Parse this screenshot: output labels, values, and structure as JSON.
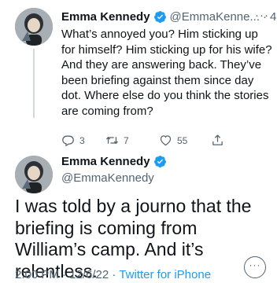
{
  "parent_tweet": {
    "author_name": "Emma Kennedy",
    "handle": "@EmmaKenne...",
    "dot": "·",
    "time": "4h",
    "more": "···",
    "text": "What’s annoyed you? Him sticking up for himself? Him sticking up for his wife? And they are answering back. They’ve been briefing against them since day dot. Where else do you think the stories are coming from?",
    "replies": "3",
    "retweets": "7",
    "likes": "55"
  },
  "main_tweet": {
    "author_name": "Emma Kennedy",
    "handle": "@EmmaKennedy",
    "text": "I was told by a journo that the briefing is coming from William’s camp. And it’s relentless.",
    "timestamp": "2:00 PM · 12/6/22 · ",
    "source": "Twitter for iPhone",
    "more": "···"
  },
  "colors": {
    "accent": "#1d9bf0",
    "secondary_text": "#536471",
    "primary_text": "#0f1419",
    "thread_line": "#cfd9de"
  },
  "icons": {
    "verified": "verified-badge-icon",
    "reply": "reply-icon",
    "retweet": "retweet-icon",
    "like": "heart-icon",
    "share": "share-icon",
    "more": "more-icon"
  }
}
